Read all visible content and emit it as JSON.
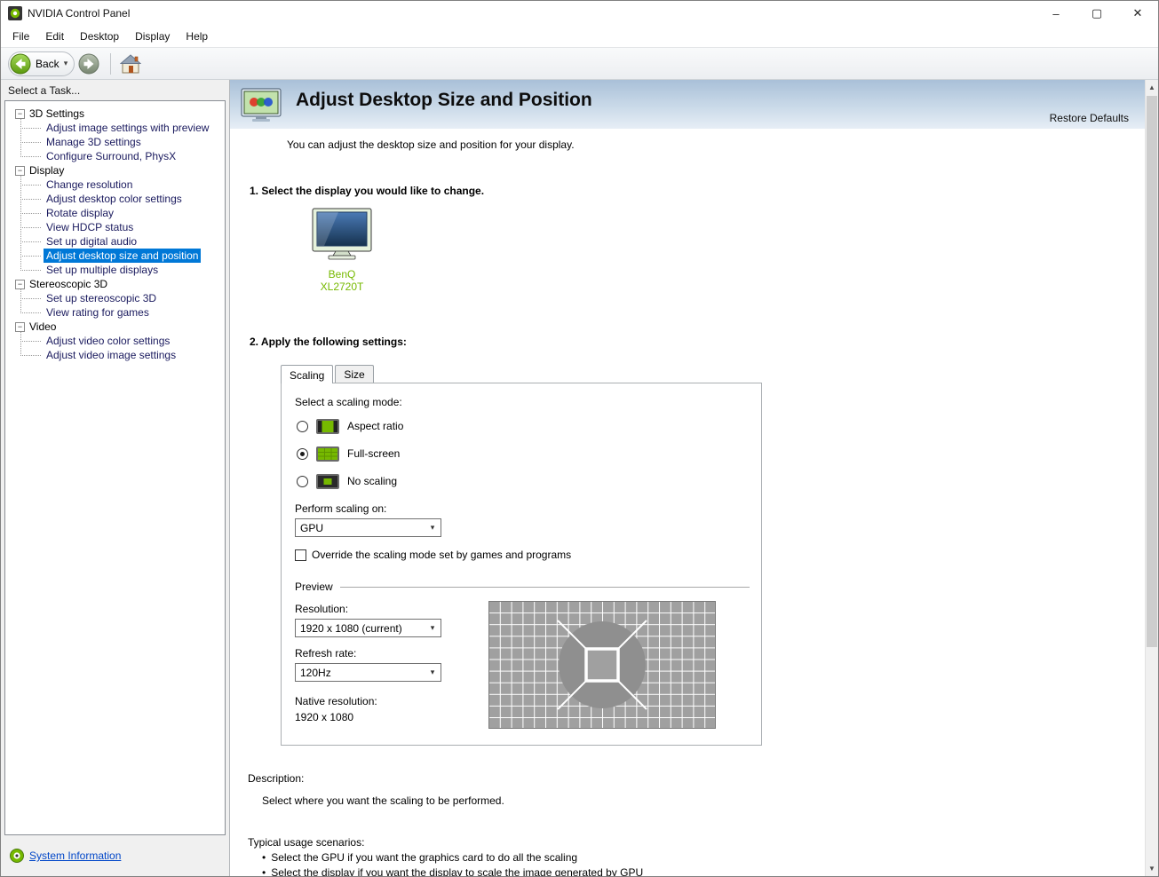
{
  "icons": {
    "minimize": "–",
    "maximize": "▢",
    "close": "✕",
    "chevron_down": "▾",
    "scroll_up": "▲",
    "scroll_down": "▼",
    "tree_collapse": "−",
    "bullet": "•"
  },
  "window": {
    "title": "NVIDIA Control Panel"
  },
  "menu": {
    "items": [
      "File",
      "Edit",
      "Desktop",
      "Display",
      "Help"
    ]
  },
  "toolbar": {
    "back_label": "Back"
  },
  "sidebar": {
    "header": "Select a Task...",
    "tree": [
      {
        "label": "3D Settings",
        "children": [
          "Adjust image settings with preview",
          "Manage 3D settings",
          "Configure Surround, PhysX"
        ]
      },
      {
        "label": "Display",
        "children": [
          "Change resolution",
          "Adjust desktop color settings",
          "Rotate display",
          "View HDCP status",
          "Set up digital audio",
          "Adjust desktop size and position",
          "Set up multiple displays"
        ]
      },
      {
        "label": "Stereoscopic 3D",
        "children": [
          "Set up stereoscopic 3D",
          "View rating for games"
        ]
      },
      {
        "label": "Video",
        "children": [
          "Adjust video color settings",
          "Adjust video image settings"
        ]
      }
    ],
    "selected_item": "Adjust desktop size and position",
    "system_information": "System Information"
  },
  "main": {
    "title": "Adjust Desktop Size and Position",
    "restore_defaults": "Restore Defaults",
    "intro": "You can adjust the desktop size and position for your display.",
    "step1_label": "1. Select the display you would like to change.",
    "display_name": "BenQ XL2720T",
    "step2_label": "2. Apply the following settings:",
    "tabs": [
      "Scaling",
      "Size"
    ],
    "active_tab": "Scaling",
    "scaling": {
      "mode_label": "Select a scaling mode:",
      "modes": [
        {
          "label": "Aspect ratio",
          "selected": false
        },
        {
          "label": "Full-screen",
          "selected": true
        },
        {
          "label": "No scaling",
          "selected": false
        }
      ],
      "perform_label": "Perform scaling on:",
      "perform_value": "GPU",
      "override_label": "Override the scaling mode set by games and programs",
      "override_checked": false,
      "preview_label": "Preview",
      "resolution_label": "Resolution:",
      "resolution_value": "1920 x 1080 (current)",
      "refresh_label": "Refresh rate:",
      "refresh_value": "120Hz",
      "native_label": "Native resolution:",
      "native_value": "1920 x 1080"
    },
    "description_label": "Description:",
    "description_text": "Select where you want the scaling to be performed.",
    "scenarios_label": "Typical usage scenarios:",
    "scenarios": [
      "Select the GPU if you want the graphics card to do all the scaling",
      "Select the display if you want the display to scale the image generated by GPU"
    ]
  },
  "colors": {
    "nvidia_green": "#76b900",
    "selection_blue": "#0078d7",
    "header_gradient_top": "#a9c0d8",
    "header_gradient_bottom": "#e7eef6"
  }
}
